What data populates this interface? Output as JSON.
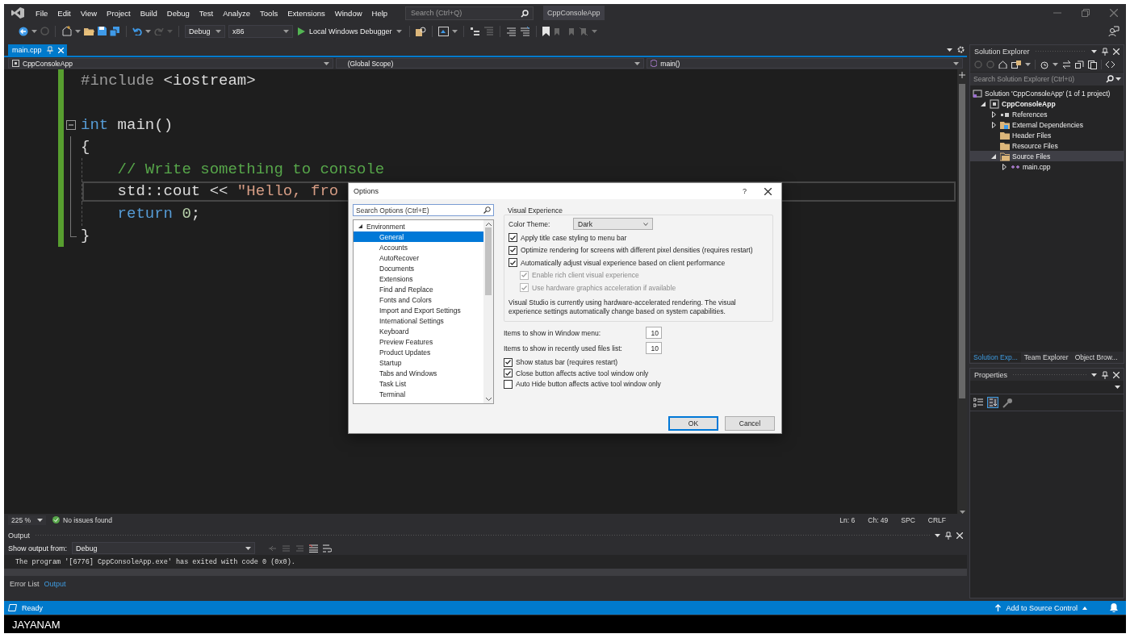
{
  "title_bar": {
    "menu": [
      "File",
      "Edit",
      "View",
      "Project",
      "Build",
      "Debug",
      "Test",
      "Analyze",
      "Tools",
      "Extensions",
      "Window",
      "Help"
    ],
    "search_placeholder": "Search (Ctrl+Q)",
    "solution_name": "CppConsoleApp"
  },
  "toolbar": {
    "configuration": "Debug",
    "platform": "x86",
    "debugger": "Local Windows Debugger"
  },
  "document_tabs": [
    {
      "label": "main.cpp",
      "selected": true
    }
  ],
  "navigation_bar": {
    "project": "CppConsoleApp",
    "scope": "(Global Scope)",
    "member": "main()"
  },
  "editor": {
    "lines": [
      {
        "kind": "code",
        "changed": true,
        "current": false,
        "tokens": [
          {
            "kind": "directive",
            "text": "#include"
          },
          {
            "kind": "plain",
            "text": " <iostream>"
          }
        ]
      },
      {
        "kind": "blank",
        "changed": true,
        "current": false
      },
      {
        "kind": "fold_start",
        "changed": true,
        "current": false,
        "tokens": [
          {
            "kind": "keyword",
            "text": "int"
          },
          {
            "kind": "plain",
            "text": " main()"
          }
        ]
      },
      {
        "kind": "code",
        "changed": true,
        "current": false,
        "tokens": [
          {
            "kind": "plain",
            "text": "{"
          }
        ]
      },
      {
        "kind": "code",
        "changed": true,
        "current": false,
        "tokens": [
          {
            "kind": "comment",
            "text": "    // Write something to console"
          }
        ]
      },
      {
        "kind": "code",
        "changed": true,
        "current": true,
        "tokens": [
          {
            "kind": "plain",
            "text": "    std::cout << "
          },
          {
            "kind": "string",
            "text": "\"Hello, fro"
          }
        ]
      },
      {
        "kind": "code",
        "changed": true,
        "current": false,
        "tokens": [
          {
            "kind": "keyword",
            "text": "    return"
          },
          {
            "kind": "number",
            "text": " 0"
          },
          {
            "kind": "plain",
            "text": ";"
          }
        ]
      },
      {
        "kind": "code",
        "changed": true,
        "current": false,
        "tokens": [
          {
            "kind": "plain",
            "text": "}"
          }
        ]
      }
    ],
    "zoom": "225 %",
    "issues": "No issues found",
    "position": [
      "Ln: 6",
      "Ch: 49",
      "SPC",
      "CRLF"
    ]
  },
  "output": {
    "title": "Output",
    "source_label": "Show output from:",
    "source": "Debug",
    "lines": [
      "The program '[6776] CppConsoleApp.exe' has exited with code 0 (0x0)."
    ],
    "tabs": [
      {
        "label": "Error List",
        "selected": false
      },
      {
        "label": "Output",
        "selected": true
      }
    ]
  },
  "solution_explorer": {
    "title": "Solution Explorer",
    "search_placeholder": "Search Solution Explorer (Ctrl+ü)",
    "tree": [
      {
        "kind": "solution",
        "label": "Solution 'CppConsoleApp' (1 of 1 project)",
        "selected": false,
        "children": [
          {
            "kind": "project",
            "label": "CppConsoleApp",
            "expanded": true,
            "selected": false,
            "children": [
              {
                "kind": "references",
                "label": "References",
                "expanded": false,
                "selected": false
              },
              {
                "kind": "external",
                "label": "External Dependencies",
                "expanded": false,
                "selected": false
              },
              {
                "kind": "folder",
                "label": "Header Files",
                "selected": false
              },
              {
                "kind": "folder",
                "label": "Resource Files",
                "selected": false
              },
              {
                "kind": "source_folder",
                "label": "Source Files",
                "expanded": true,
                "selected": true,
                "children": [
                  {
                    "kind": "cpp",
                    "label": "main.cpp",
                    "expanded": false,
                    "selected": false
                  }
                ]
              }
            ]
          }
        ]
      }
    ],
    "tabs": [
      {
        "label": "Solution Exp...",
        "selected": true
      },
      {
        "label": "Team Explorer",
        "selected": false
      },
      {
        "label": "Object Brow...",
        "selected": false
      }
    ]
  },
  "properties": {
    "title": "Properties"
  },
  "status_bar": {
    "status": "Ready",
    "source_control": "Add to Source Control"
  },
  "footer": {
    "text": "JAYANAM"
  },
  "options_dialog": {
    "title": "Options",
    "help": "?",
    "search_placeholder": "Search Options (Ctrl+E)",
    "tree": [
      {
        "label": "Environment",
        "expanded": true,
        "selected": false,
        "children": [
          {
            "label": "General",
            "selected": true
          },
          {
            "label": "Accounts",
            "selected": false
          },
          {
            "label": "AutoRecover",
            "selected": false
          },
          {
            "label": "Documents",
            "selected": false
          },
          {
            "label": "Extensions",
            "selected": false
          },
          {
            "label": "Find and Replace",
            "selected": false
          },
          {
            "label": "Fonts and Colors",
            "selected": false
          },
          {
            "label": "Import and Export Settings",
            "selected": false
          },
          {
            "label": "International Settings",
            "selected": false
          },
          {
            "label": "Keyboard",
            "selected": false
          },
          {
            "label": "Preview Features",
            "selected": false
          },
          {
            "label": "Product Updates",
            "selected": false
          },
          {
            "label": "Startup",
            "selected": false
          },
          {
            "label": "Tabs and Windows",
            "selected": false
          },
          {
            "label": "Task List",
            "selected": false
          },
          {
            "label": "Terminal",
            "selected": false
          }
        ]
      }
    ],
    "group_title": "Visual Experience",
    "theme_label": "Color Theme:",
    "theme": "Dark",
    "group_checkboxes": [
      {
        "label": "Apply title case styling to menu bar",
        "checked": true,
        "disabled": false,
        "indented": false
      },
      {
        "label": "Optimize rendering for screens with different pixel densities (requires restart)",
        "checked": true,
        "disabled": false,
        "indented": false
      },
      {
        "label": "Automatically adjust visual experience based on client performance",
        "checked": true,
        "disabled": false,
        "indented": false
      },
      {
        "label": "Enable rich client visual experience",
        "checked": true,
        "disabled": true,
        "indented": true
      },
      {
        "label": "Use hardware graphics acceleration if available",
        "checked": true,
        "disabled": true,
        "indented": true
      }
    ],
    "note": "Visual Studio is currently using hardware-accelerated rendering. The visual experience settings automatically change based on system capabilities.",
    "number_fields": [
      {
        "label": "Items to show in Window menu:",
        "value": "10"
      },
      {
        "label": "Items to show in recently used files list:",
        "value": "10"
      }
    ],
    "checkboxes": [
      {
        "label": "Show status bar (requires restart)",
        "checked": true,
        "disabled": false
      },
      {
        "label": "Close button affects active tool window only",
        "checked": true,
        "disabled": false
      },
      {
        "label": "Auto Hide button affects active tool window only",
        "checked": false,
        "disabled": false
      }
    ],
    "buttons": [
      {
        "label": "OK",
        "default": true
      },
      {
        "label": "Cancel",
        "default": false
      }
    ]
  }
}
